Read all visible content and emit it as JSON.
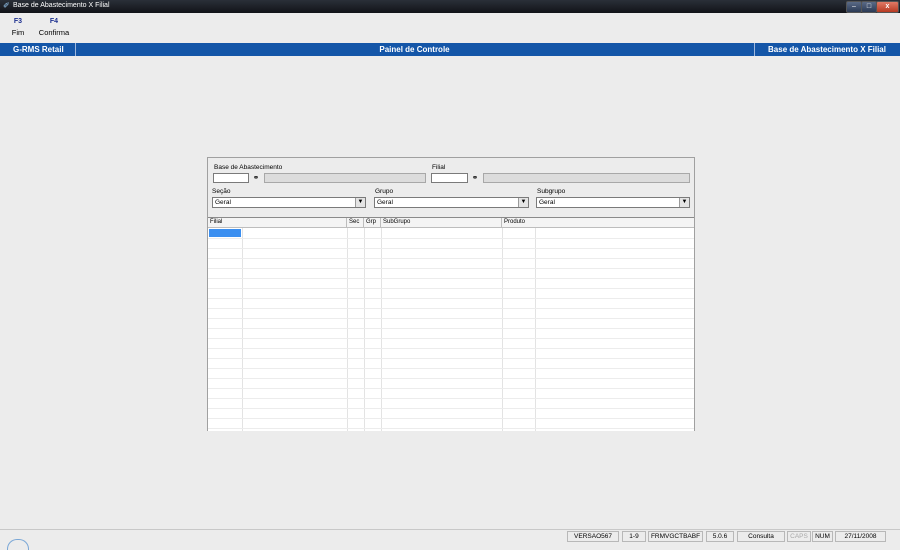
{
  "window": {
    "title": "Base de Abastecimento X Filial",
    "controls": {
      "minimize": "–",
      "maximize": "□",
      "close": "x"
    }
  },
  "toolbar": [
    {
      "key": "F3",
      "label": "Fim"
    },
    {
      "key": "F4",
      "label": "Confirma"
    }
  ],
  "header": {
    "left": "G-RMS Retail",
    "center": "Painel de Controle",
    "right": "Base de Abastecimento X Filial"
  },
  "form": {
    "base_label": "Base de Abastecimento",
    "base_value": "",
    "filial_label": "Filial",
    "filial_value": "",
    "secao_label": "Seção",
    "secao_value": "Geral",
    "grupo_label": "Grupo",
    "grupo_value": "Geral",
    "subgrupo_label": "Subgrupo",
    "subgrupo_value": "Geral"
  },
  "grid": {
    "columns": [
      "Filial",
      "Sec",
      "Grp",
      "SubGrupo",
      "Produto"
    ],
    "rows": []
  },
  "icons": {
    "lookup": "binoculars-icon",
    "dropdown": "chevron-down-icon"
  },
  "statusbar": [
    "VERSAO567",
    "1-9",
    "FRMVGCTBABF",
    "5.0.6",
    "Consulta",
    "CAPS",
    "NUM",
    "27/11/2008"
  ],
  "colors": {
    "header_bar": "#1456a8",
    "function_key": "#1c2f8f",
    "selected_cell": "#3b8ff0"
  }
}
